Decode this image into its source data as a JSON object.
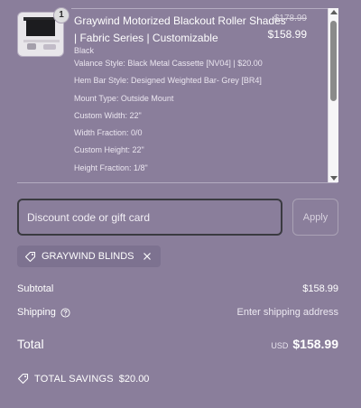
{
  "product": {
    "quantity": "1",
    "title": "Graywind Motorized Blackout Roller Shades | Fabric Series | Customizable",
    "compare_price": "$178.99",
    "price": "$158.99",
    "variants": [
      "Black",
      "Valance Style: Black Metal Cassette [NV04] | $20.00",
      "Hem Bar Style: Designed Weighted Bar- Grey [BR4]",
      "Mount Type: Outside Mount",
      "Custom Width: 22\"",
      "Width Fraction: 0/0",
      "Custom Height: 22\"",
      "Height Fraction: 1/8\""
    ]
  },
  "discount": {
    "placeholder": "Discount code or gift card",
    "apply_label": "Apply",
    "applied_code": "GRAYWIND BLINDS"
  },
  "totals": {
    "subtotal_label": "Subtotal",
    "subtotal_value": "$158.99",
    "shipping_label": "Shipping",
    "shipping_value": "Enter shipping address",
    "total_label": "Total",
    "currency": "USD",
    "total_value": "$158.99",
    "savings_label": "TOTAL SAVINGS",
    "savings_value": "$20.00"
  },
  "icons": {
    "tag": "tag-icon",
    "remove": "close-icon",
    "help": "help-icon"
  },
  "colors": {
    "background": "#8a7e9b",
    "text": "#ffffff"
  }
}
